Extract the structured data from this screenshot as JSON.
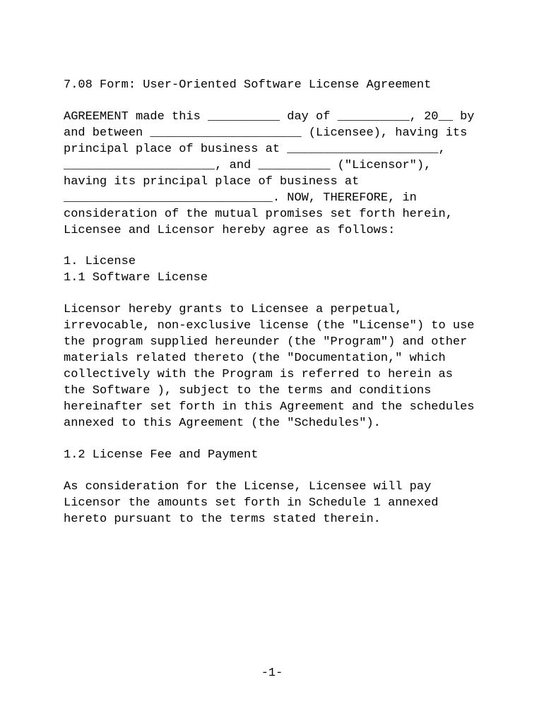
{
  "title": "7.08 Form: User-Oriented Software License Agreement",
  "preamble": "AGREEMENT made this __________ day of __________, 20__ by and between _____________________ (Licensee), having its principal place of business at _____________________, _____________________, and __________ (\"Licensor\"), having its principal place of business at _____________________________. NOW, THEREFORE, in consideration of the mutual promises set forth herein, Licensee and Licensor hereby agree as follows:",
  "section1": {
    "heading": "1. License",
    "sub1": {
      "heading": "1.1 Software License",
      "body": "Licensor hereby grants to Licensee a perpetual, irrevocable, non-exclusive license (the \"License\") to use the program supplied hereunder (the \"Program\") and other materials related thereto (the \"Documentation,\" which collectively with the Program is referred to herein as the Software ), subject to the terms and conditions hereinafter set forth in this Agreement and the schedules annexed to this Agreement (the \"Schedules\")."
    },
    "sub2": {
      "heading": "1.2 License Fee and Payment",
      "body": "As consideration for the License, Licensee will pay Licensor the amounts set forth in Schedule 1 annexed hereto pursuant to the terms stated therein."
    }
  },
  "pageNumber": "-1-"
}
